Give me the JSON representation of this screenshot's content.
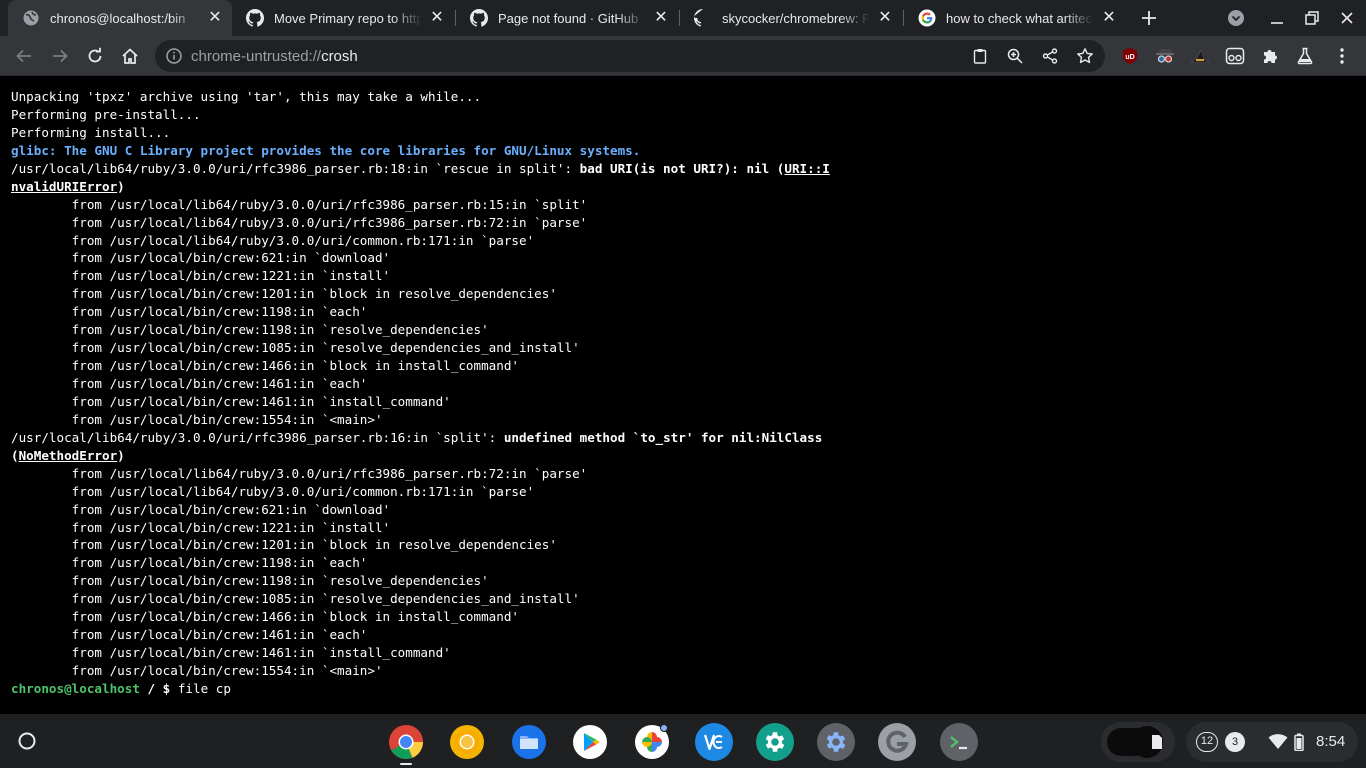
{
  "tabs": [
    {
      "title": "chronos@localhost:/bin",
      "favicon": "crosh-globe-icon",
      "active": true
    },
    {
      "title": "Move Primary repo to https",
      "favicon": "github-icon",
      "active": false
    },
    {
      "title": "Page not found · GitHub",
      "favicon": "github-icon",
      "active": false
    },
    {
      "title": "skycocker/chromebrew: Pa",
      "favicon": "github-icon",
      "active": false
    },
    {
      "title": "how to check what artitec",
      "favicon": "google-icon",
      "active": false
    }
  ],
  "omnibox": {
    "scheme": "chrome-untrusted://",
    "host": "crosh"
  },
  "terminal": {
    "lines": [
      "Unpacking 'tpxz' archive using 'tar', this may take a while...",
      "Performing pre-install...",
      "Performing install...",
      "glibc: The GNU C Library project provides the core libraries for GNU/Linux systems.",
      "/usr/local/lib64/ruby/3.0.0/uri/rfc3986_parser.rb:18:in `rescue in split': ",
      "bad URI(is not URI?): nil (",
      "URI::I",
      "nvalidURIError",
      ")",
      "        from /usr/local/lib64/ruby/3.0.0/uri/rfc3986_parser.rb:15:in `split'",
      "        from /usr/local/lib64/ruby/3.0.0/uri/rfc3986_parser.rb:72:in `parse'",
      "        from /usr/local/lib64/ruby/3.0.0/uri/common.rb:171:in `parse'",
      "        from /usr/local/bin/crew:621:in `download'",
      "        from /usr/local/bin/crew:1221:in `install'",
      "        from /usr/local/bin/crew:1201:in `block in resolve_dependencies'",
      "        from /usr/local/bin/crew:1198:in `each'",
      "        from /usr/local/bin/crew:1198:in `resolve_dependencies'",
      "        from /usr/local/bin/crew:1085:in `resolve_dependencies_and_install'",
      "        from /usr/local/bin/crew:1466:in `block in install_command'",
      "        from /usr/local/bin/crew:1461:in `each'",
      "        from /usr/local/bin/crew:1461:in `install_command'",
      "        from /usr/local/bin/crew:1554:in `<main>'",
      "/usr/local/lib64/ruby/3.0.0/uri/rfc3986_parser.rb:16:in `split': ",
      "undefined method `to_str' for nil:NilClass",
      "(",
      "NoMethodError",
      ")",
      "        from /usr/local/lib64/ruby/3.0.0/uri/rfc3986_parser.rb:72:in `parse'",
      "        from /usr/local/lib64/ruby/3.0.0/uri/common.rb:171:in `parse'",
      "        from /usr/local/bin/crew:621:in `download'",
      "        from /usr/local/bin/crew:1221:in `install'",
      "        from /usr/local/bin/crew:1201:in `block in resolve_dependencies'",
      "        from /usr/local/bin/crew:1198:in `each'",
      "        from /usr/local/bin/crew:1198:in `resolve_dependencies'",
      "        from /usr/local/bin/crew:1085:in `resolve_dependencies_and_install'",
      "        from /usr/local/bin/crew:1466:in `block in install_command'",
      "        from /usr/local/bin/crew:1461:in `each'",
      "        from /usr/local/bin/crew:1461:in `install_command'",
      "        from /usr/local/bin/crew:1554:in `<main>'"
    ],
    "prompt_user": "chronos@localhost",
    "prompt_path": " / $ ",
    "prompt_command": "file cp"
  },
  "tray": {
    "notification_count": "12",
    "badge_count": "3",
    "clock": "8:54"
  },
  "colors": {
    "terminal_bg": "#000000",
    "terminal_fg": "#ffffff",
    "terminal_info": "#6ab0ff",
    "prompt_green": "#4ec36b",
    "chrome_frame": "#202124",
    "chrome_toolbar": "#35363a"
  }
}
